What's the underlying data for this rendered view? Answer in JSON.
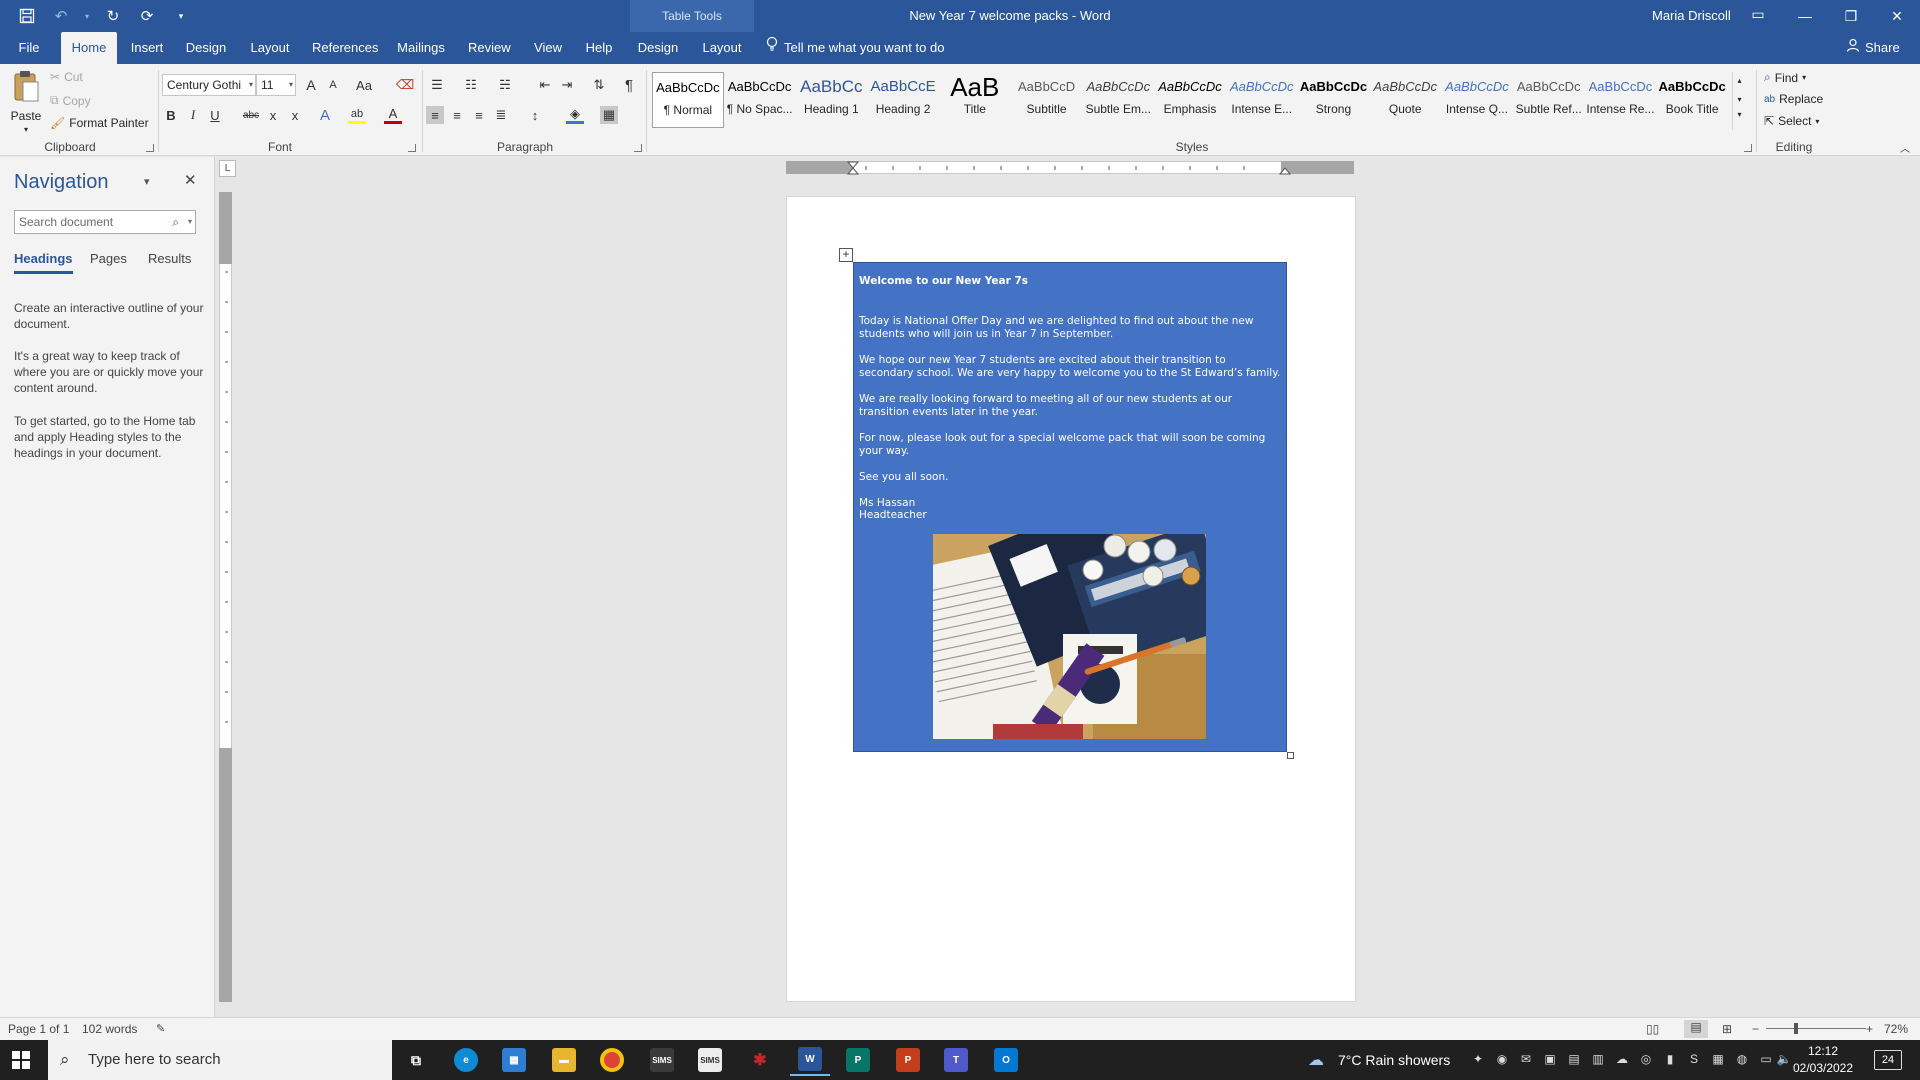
{
  "titlebar": {
    "doc_title": "New Year 7 welcome packs  -  Word",
    "contextual_label": "Table Tools",
    "user_name": "Maria Driscoll"
  },
  "ribbon_tabs": [
    "File",
    "Home",
    "Insert",
    "Design",
    "Layout",
    "References",
    "Mailings",
    "Review",
    "View",
    "Help",
    "Design",
    "Layout"
  ],
  "active_tab": "Home",
  "tell_me": "Tell me what you want to do",
  "share_label": "Share",
  "clipboard": {
    "paste": "Paste",
    "cut": "Cut",
    "copy": "Copy",
    "format_painter": "Format Painter",
    "group_label": "Clipboard"
  },
  "font": {
    "family": "Century Gothi",
    "size": "11",
    "grow_label": "A",
    "shrink_label": "A",
    "case_label": "Aa",
    "bold": "B",
    "italic": "I",
    "underline": "U",
    "strike": "abc",
    "subscript": "x",
    "superscript": "x",
    "effects_label": "A",
    "highlight_label": "ab",
    "color_label": "A",
    "group_label": "Font"
  },
  "paragraph": {
    "pilcrow": "¶",
    "group_label": "Paragraph"
  },
  "styles": {
    "items": [
      {
        "preview": "AaBbCcDc",
        "name": "¶ Normal",
        "color": "#000000"
      },
      {
        "preview": "AaBbCcDc",
        "name": "¶ No Spac...",
        "color": "#000000"
      },
      {
        "preview": "AaBbCc",
        "name": "Heading 1",
        "color": "#2f5597"
      },
      {
        "preview": "AaBbCcE",
        "name": "Heading 2",
        "color": "#2f5597"
      },
      {
        "preview": "AaB",
        "name": "Title",
        "color": "#000000"
      },
      {
        "preview": "AaBbCcD",
        "name": "Subtitle",
        "color": "#595959"
      },
      {
        "preview": "AaBbCcDc",
        "name": "Subtle Em...",
        "color": "#404040"
      },
      {
        "preview": "AaBbCcDc",
        "name": "Emphasis",
        "color": "#000000"
      },
      {
        "preview": "AaBbCcDc",
        "name": "Intense E...",
        "color": "#4472c4"
      },
      {
        "preview": "AaBbCcDc",
        "name": "Strong",
        "color": "#000000"
      },
      {
        "preview": "AaBbCcDc",
        "name": "Quote",
        "color": "#404040"
      },
      {
        "preview": "AaBbCcDc",
        "name": "Intense Q...",
        "color": "#4472c4"
      },
      {
        "preview": "AaBbCcDc",
        "name": "Subtle Ref...",
        "color": "#595959"
      },
      {
        "preview": "AaBbCcDc",
        "name": "Intense Re...",
        "color": "#4472c4"
      },
      {
        "preview": "AaBbCcDc",
        "name": "Book Title",
        "color": "#000000"
      }
    ],
    "group_label": "Styles"
  },
  "editing": {
    "find": "Find",
    "replace": "Replace",
    "select": "Select",
    "group_label": "Editing"
  },
  "navigation": {
    "title": "Navigation",
    "search_placeholder": "Search document",
    "tabs": [
      "Headings",
      "Pages",
      "Results"
    ],
    "paragraphs": [
      "Create an interactive outline of your document.",
      "It's a great way to keep track of where you are or quickly move your content around.",
      "To get started, go to the Home tab and apply Heading styles to the headings in your document."
    ]
  },
  "document": {
    "heading": "Welcome to our New Year 7s",
    "paragraphs": [
      "Today is National Offer Day and we are delighted to find out about the new students who will join us in Year 7 in September.",
      "We hope our new Year 7 students are excited about their transition to secondary school.  We are very happy to welcome you to the St Edward’s family.",
      "We are really looking forward to meeting all of our new students at our transition events later in the year.",
      "For now, please look out for a special welcome pack that will soon be coming your way.",
      "See you all soon."
    ],
    "signature_name": "Ms Hassan",
    "signature_role": "Headteacher",
    "cell_color": "#4472c4"
  },
  "statusbar": {
    "page": "Page 1 of 1",
    "words": "102 words",
    "zoom": "72%"
  },
  "taskbar": {
    "search_placeholder": "Type here to search",
    "weather": "7°C  Rain showers",
    "time": "12:12",
    "date": "02/03/2022",
    "notifications": "24"
  }
}
